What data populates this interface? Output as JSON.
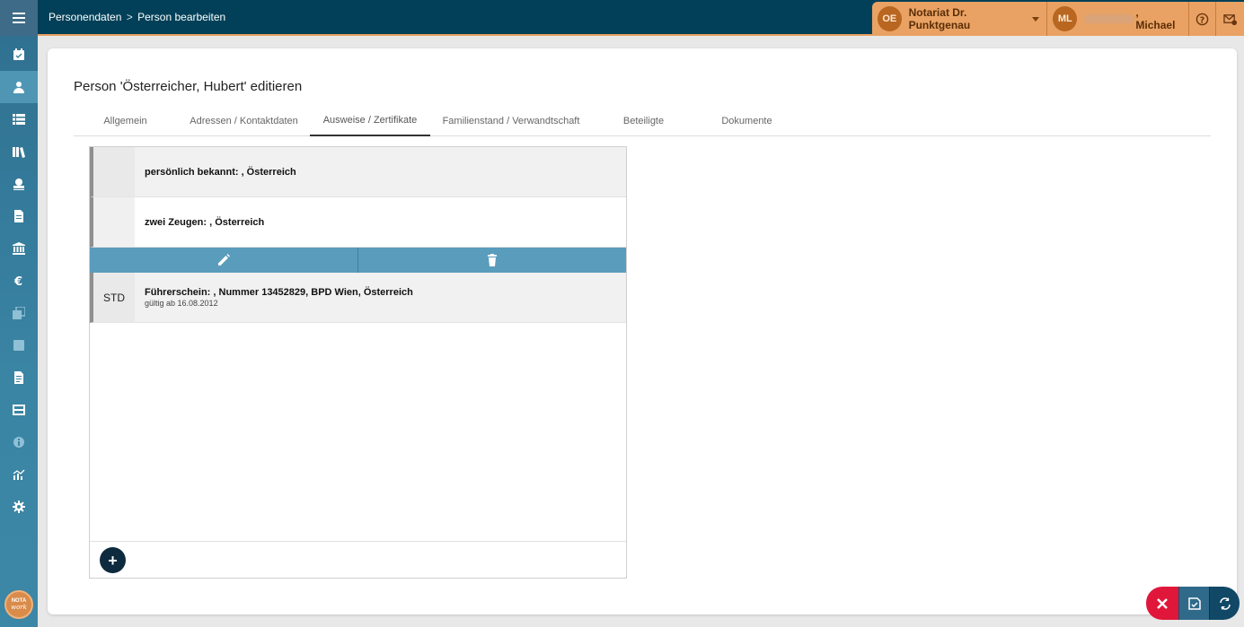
{
  "app": {
    "breadcrumb": {
      "parent": "Personendaten",
      "separator": ">",
      "current": "Person bearbeiten"
    }
  },
  "topbar": {
    "org_initials": "OE",
    "org_name": "Notariat Dr. Punktgenau",
    "user_initials": "ML",
    "user_name": ", Michael",
    "icons": [
      "help-icon",
      "mail-icon"
    ]
  },
  "sidebar": {
    "items": [
      {
        "icon": "calendar-check-icon",
        "active": false
      },
      {
        "icon": "person-icon",
        "active": true
      },
      {
        "icon": "list-icon",
        "active": false
      },
      {
        "icon": "books-icon",
        "active": false
      },
      {
        "icon": "stamp-icon",
        "active": false
      },
      {
        "icon": "document-icon",
        "active": false
      },
      {
        "icon": "bank-icon",
        "active": false
      },
      {
        "icon": "euro-icon",
        "active": false
      },
      {
        "icon": "copy-icon",
        "active": false
      },
      {
        "icon": "square-icon",
        "active": false
      },
      {
        "icon": "file-text-icon",
        "active": false
      },
      {
        "icon": "table-icon",
        "active": false
      },
      {
        "icon": "info-icon",
        "active": false
      },
      {
        "icon": "chart-icon",
        "active": false
      },
      {
        "icon": "gear-icon",
        "active": false
      }
    ],
    "logo_line1": "NOTA",
    "logo_line2": "work"
  },
  "page": {
    "title": "Person 'Österreicher, Hubert' editieren",
    "tabs": [
      {
        "label": "Allgemein"
      },
      {
        "label": "Adressen / Kontaktdaten"
      },
      {
        "label": "Ausweise / Zertifikate",
        "active": true
      },
      {
        "label": "Familienstand / Verwandtschaft"
      },
      {
        "label": "Beteiligte"
      },
      {
        "label": "Dokumente"
      }
    ],
    "documents": [
      {
        "tag": "",
        "main": "persönlich bekannt: , Österreich",
        "sub": ""
      },
      {
        "tag": "",
        "main": "zwei Zeugen: , Österreich",
        "sub": ""
      },
      {
        "tag": "STD",
        "main": "Führerschein: , Nummer 13452829, BPD Wien, Österreich",
        "sub": "gültig ab 16.08.2012"
      }
    ],
    "add_label": "+"
  }
}
